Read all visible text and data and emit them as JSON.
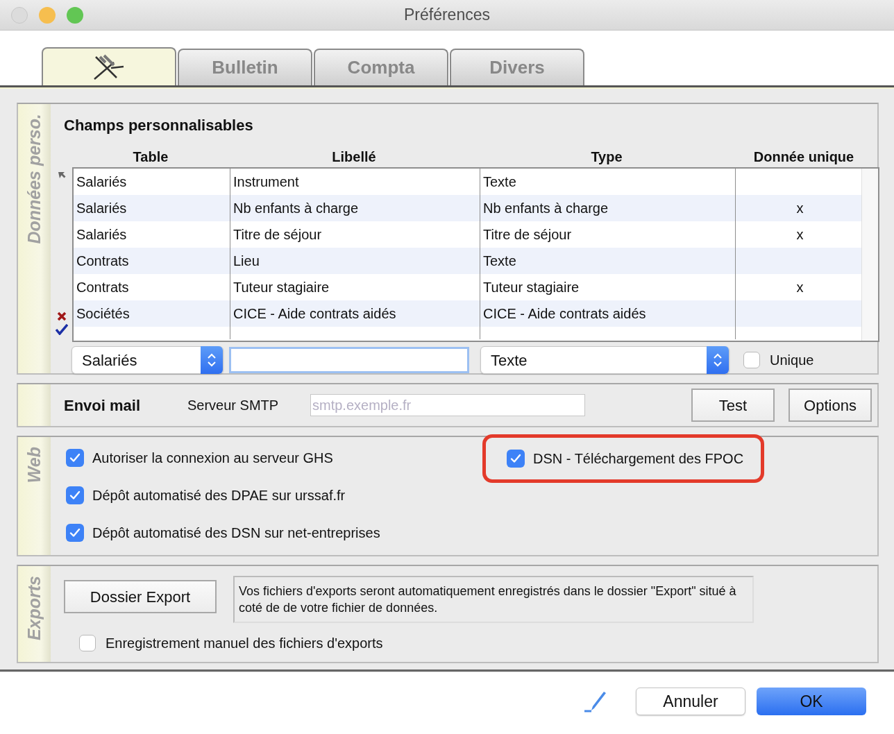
{
  "window": {
    "title": "Préférences"
  },
  "tabs": [
    {
      "kind": "icon",
      "selected": true
    },
    {
      "kind": "text",
      "label": "Bulletin",
      "selected": false
    },
    {
      "kind": "text",
      "label": "Compta",
      "selected": false
    },
    {
      "kind": "text",
      "label": "Divers",
      "selected": false
    }
  ],
  "custom_fields": {
    "side_label": "Données perso.",
    "title": "Champs personnalisables",
    "columns": [
      "Table",
      "Libellé",
      "Type",
      "Donnée unique"
    ],
    "rows": [
      {
        "table": "Salariés",
        "label": "Instrument",
        "type": "Texte",
        "current": true
      },
      {
        "table": "Salariés",
        "label": "Nb enfants à charge",
        "type": "Nb enfants à charge",
        "unique": "x",
        "current": false
      },
      {
        "table": "Salariés",
        "label": "Titre de séjour",
        "type": "Titre de séjour",
        "unique": "x",
        "current": false
      },
      {
        "table": "Contrats",
        "label": "Lieu",
        "type": "Texte",
        "current": false
      },
      {
        "table": "Contrats",
        "label": "Tuteur stagiaire",
        "type": "Tuteur stagiaire",
        "unique": "x",
        "current": false
      },
      {
        "table": "Sociétés",
        "label": "CICE - Aide contrats aidés",
        "type": "CICE - Aide contrats aidés",
        "current": false
      }
    ],
    "new_entry": {
      "table": "Salariés",
      "type": "Texte",
      "unique": {
        "label": "Unique",
        "checked": false
      }
    }
  },
  "mail": {
    "title": "Envoi mail",
    "smtp_label": "Serveur SMTP",
    "smtp": {
      "placeholder": "smtp.exemple.fr"
    },
    "buttons": [
      "Test",
      "Options"
    ]
  },
  "web": {
    "side_label": "Web",
    "left_options": [
      {
        "label": "Autoriser la connexion au serveur GHS",
        "checked": true,
        "highlighted": false
      },
      {
        "label": "Dépôt automatisé des DPAE sur urssaf.fr",
        "checked": true,
        "highlighted": false
      },
      {
        "label": "Dépôt automatisé des DSN sur net-entreprises",
        "checked": true,
        "highlighted": false
      }
    ],
    "right_options": [
      {
        "label": "DSN - Téléchargement des FPOC",
        "checked": true,
        "highlighted": true
      }
    ]
  },
  "exports": {
    "side_label": "Exports",
    "button": "Dossier Export",
    "note": "Vos fichiers d'exports seront automatiquement enregistrés dans le dossier \"Export\" situé à coté de de votre fichier de données.",
    "manual": {
      "label": "Enregistrement manuel des fichiers d'exports",
      "checked": false
    }
  },
  "footer": {
    "buttons": [
      {
        "label": "Annuler",
        "kind": "default"
      },
      {
        "label": "OK",
        "kind": "primary"
      }
    ]
  }
}
